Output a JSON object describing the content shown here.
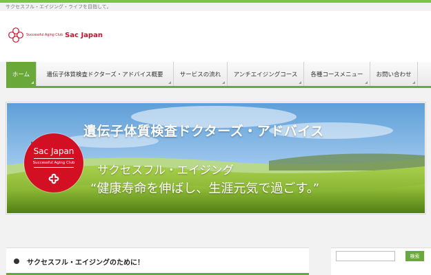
{
  "site": {
    "tagline": "サクセスフル・エイジング・ライフを目指して。",
    "logo_small_text": "Successful Aging Club",
    "logo_text": "Sac Japan"
  },
  "nav": {
    "items": [
      {
        "label": "ホーム",
        "active": true
      },
      {
        "label": "遺伝子体質検査ドクターズ・アドバイス概要",
        "active": false
      },
      {
        "label": "サービスの流れ",
        "active": false
      },
      {
        "label": "アンチエイジングコース",
        "active": false
      },
      {
        "label": "各種コースメニュー",
        "active": false
      },
      {
        "label": "お問い合わせ",
        "active": false
      }
    ]
  },
  "banner": {
    "title": "遺伝子体質検査ドクターズ・アドバイス",
    "line1": "サクセスフル・エイジング",
    "line2": "“健康寿命を伸ばし、生涯元気で過ごす。”",
    "badge_name": "Sac Japan",
    "badge_sub": "Successful Aging Club"
  },
  "content": {
    "heading": "サクセスフル・エイジングのために！"
  },
  "sidebar": {
    "search_value": "",
    "search_button": "検索"
  },
  "colors": {
    "accent_green": "#6aa939",
    "brand_red": "#c8102e"
  },
  "icons": {
    "logo": "logo-cross-icon",
    "badge": "cross-icon",
    "bullet": "bullet-icon"
  }
}
